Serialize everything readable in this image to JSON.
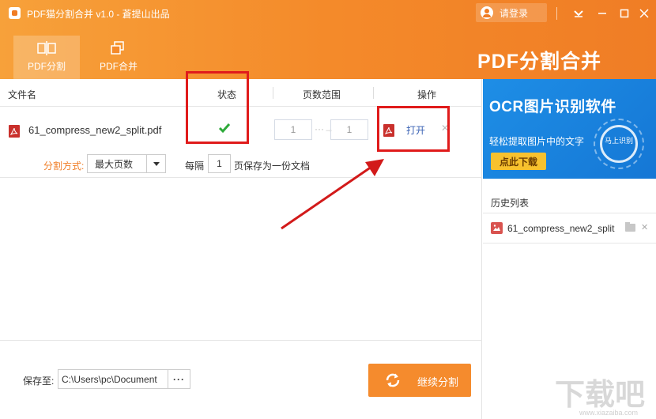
{
  "window": {
    "title": "PDF猫分割合并 v1.0 - 蒼提山出品",
    "login_label": "请登录",
    "controls": [
      "menu-icon",
      "minimize-icon",
      "close-icon"
    ]
  },
  "tabs": [
    {
      "label": "PDF分割",
      "active": true
    },
    {
      "label": "PDF合并",
      "active": false
    }
  ],
  "brand_title": "PDF分割合并",
  "table": {
    "headers": {
      "filename": "文件名",
      "status": "状态",
      "page_range": "页数范围",
      "action": "操作"
    },
    "rows": [
      {
        "filename": "61_compress_new2_split.pdf",
        "status": "done",
        "page_from": "1",
        "page_to": "1",
        "action": "打开"
      }
    ]
  },
  "split": {
    "label": "分割方式:",
    "mode_value": "最大页数",
    "every_label": "每隔",
    "every_value": "1",
    "every_suffix": "页保存为一份文档"
  },
  "bottom": {
    "save_label": "保存至:",
    "save_path": "C:\\Users\\pc\\Document",
    "browse_label": "···",
    "continue_label": "继续分割"
  },
  "ad": {
    "title": "OCR图片识别软件",
    "subtitle": "轻松提取图片中的文字",
    "button": "点此下载",
    "badge": "马上识别"
  },
  "history": {
    "title": "历史列表",
    "items": [
      {
        "name": "61_compress_new2_split"
      }
    ]
  },
  "watermark": {
    "text": "下载吧",
    "sub": "www.xiazaiba.com"
  },
  "colors": {
    "accent": "#f07d25",
    "link": "#3a62b4",
    "annotation": "#e01b1b",
    "ad": "#1a82dd"
  }
}
